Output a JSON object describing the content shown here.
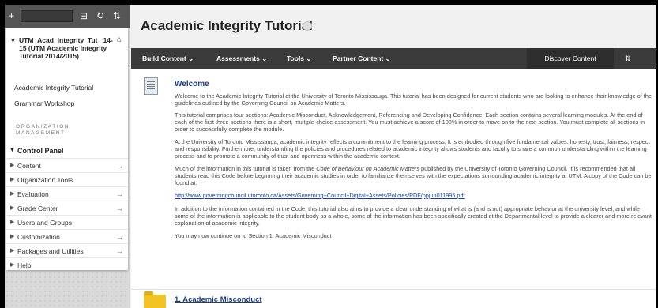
{
  "sidebar": {
    "toolbar": {
      "add_icon": "+",
      "folder_icon": "⊟",
      "refresh_icon": "↻",
      "sort_icon": "⇅"
    },
    "course_title": "UTM_Acad_Integrity_Tut_ 14-15 (UTM Academic Integrity Tutorial 2014/2015)",
    "course_links": [
      "Academic Integrity Tutorial",
      "Grammar Workshop"
    ],
    "org_label": "ORGANIZATION MANAGEMENT",
    "control_panel": {
      "label": "Control Panel",
      "items": [
        {
          "label": "Content",
          "arrow": true
        },
        {
          "label": "Organization Tools",
          "arrow": false
        },
        {
          "label": "Evaluation",
          "arrow": true
        },
        {
          "label": "Grade Center",
          "arrow": true
        },
        {
          "label": "Users and Groups",
          "arrow": false
        },
        {
          "label": "Customization",
          "arrow": true
        },
        {
          "label": "Packages and Utilities",
          "arrow": true
        },
        {
          "label": "Help",
          "arrow": false
        }
      ]
    }
  },
  "main": {
    "page_title": "Academic Integrity Tutorial",
    "menubar": {
      "items": [
        "Build Content ⌄",
        "Assessments ⌄",
        "Tools ⌄",
        "Partner Content ⌄"
      ],
      "discover": "Discover Content",
      "sort_icon": "⇅"
    },
    "welcome": {
      "title": "Welcome",
      "p1": "Welcome to the Academic Integrity Tutorial at the University of Toronto Mississauga. This tutorial has been designed for current students who are looking to enhance their knowledge of the guidelines outlined by the Governing Council on Academic Matters.",
      "p2": "This tutorial comprises four sections: Academic Misconduct, Acknowledgement, Referencing and Developing Confidence. Each section contains several learning modules. At the end of each of the first three sections there is a short, multiple-choice assessment. You must achieve a score of 100% in order to move on to the next section. You must complete all sections in order to successfully complete the module.",
      "p3": "At the University of Toronto Mississauga, academic integrity reflects a commitment to the learning process. It is embodied through five fundamental values: honesty, trust, fairness, respect and responsibility. Furthermore, understanding the policies and procedures related to academic integrity allows students and faculty to share a common understanding within the learning process and to promote a community of trust and openness within the academic context.",
      "p4a": "Much of the information in this tutorial is taken from the ",
      "p4b": "Code of Behaviour on Academic Matters",
      "p4c": " published by the University of Toronto Governing Council. It is recommended that all students read this Code before beginning their academic studies in order to familiarize themselves with the expectations surrounding academic integrity at UTM. A copy of the Code can be found at:",
      "link": "http://www.governingcouncil.utoronto.ca/Assets/Governing+Council+Digital+Assets/Policies/PDF/ppjun011995.pdf",
      "p5": "In addition to the information contained in the Code, this tutorial also aims to provide a clear understanding of what is (and is not) appropriate behavior at the university level, and while some of the information is applicable to the student body as a whole, some of the information has been specifically created at the Departmental level to provide a clearer and more relevant explanation of academic integrity.",
      "p6": "You may now continue on to Section 1: Academic Misconduct"
    },
    "section1": "1. Academic Misconduct"
  }
}
